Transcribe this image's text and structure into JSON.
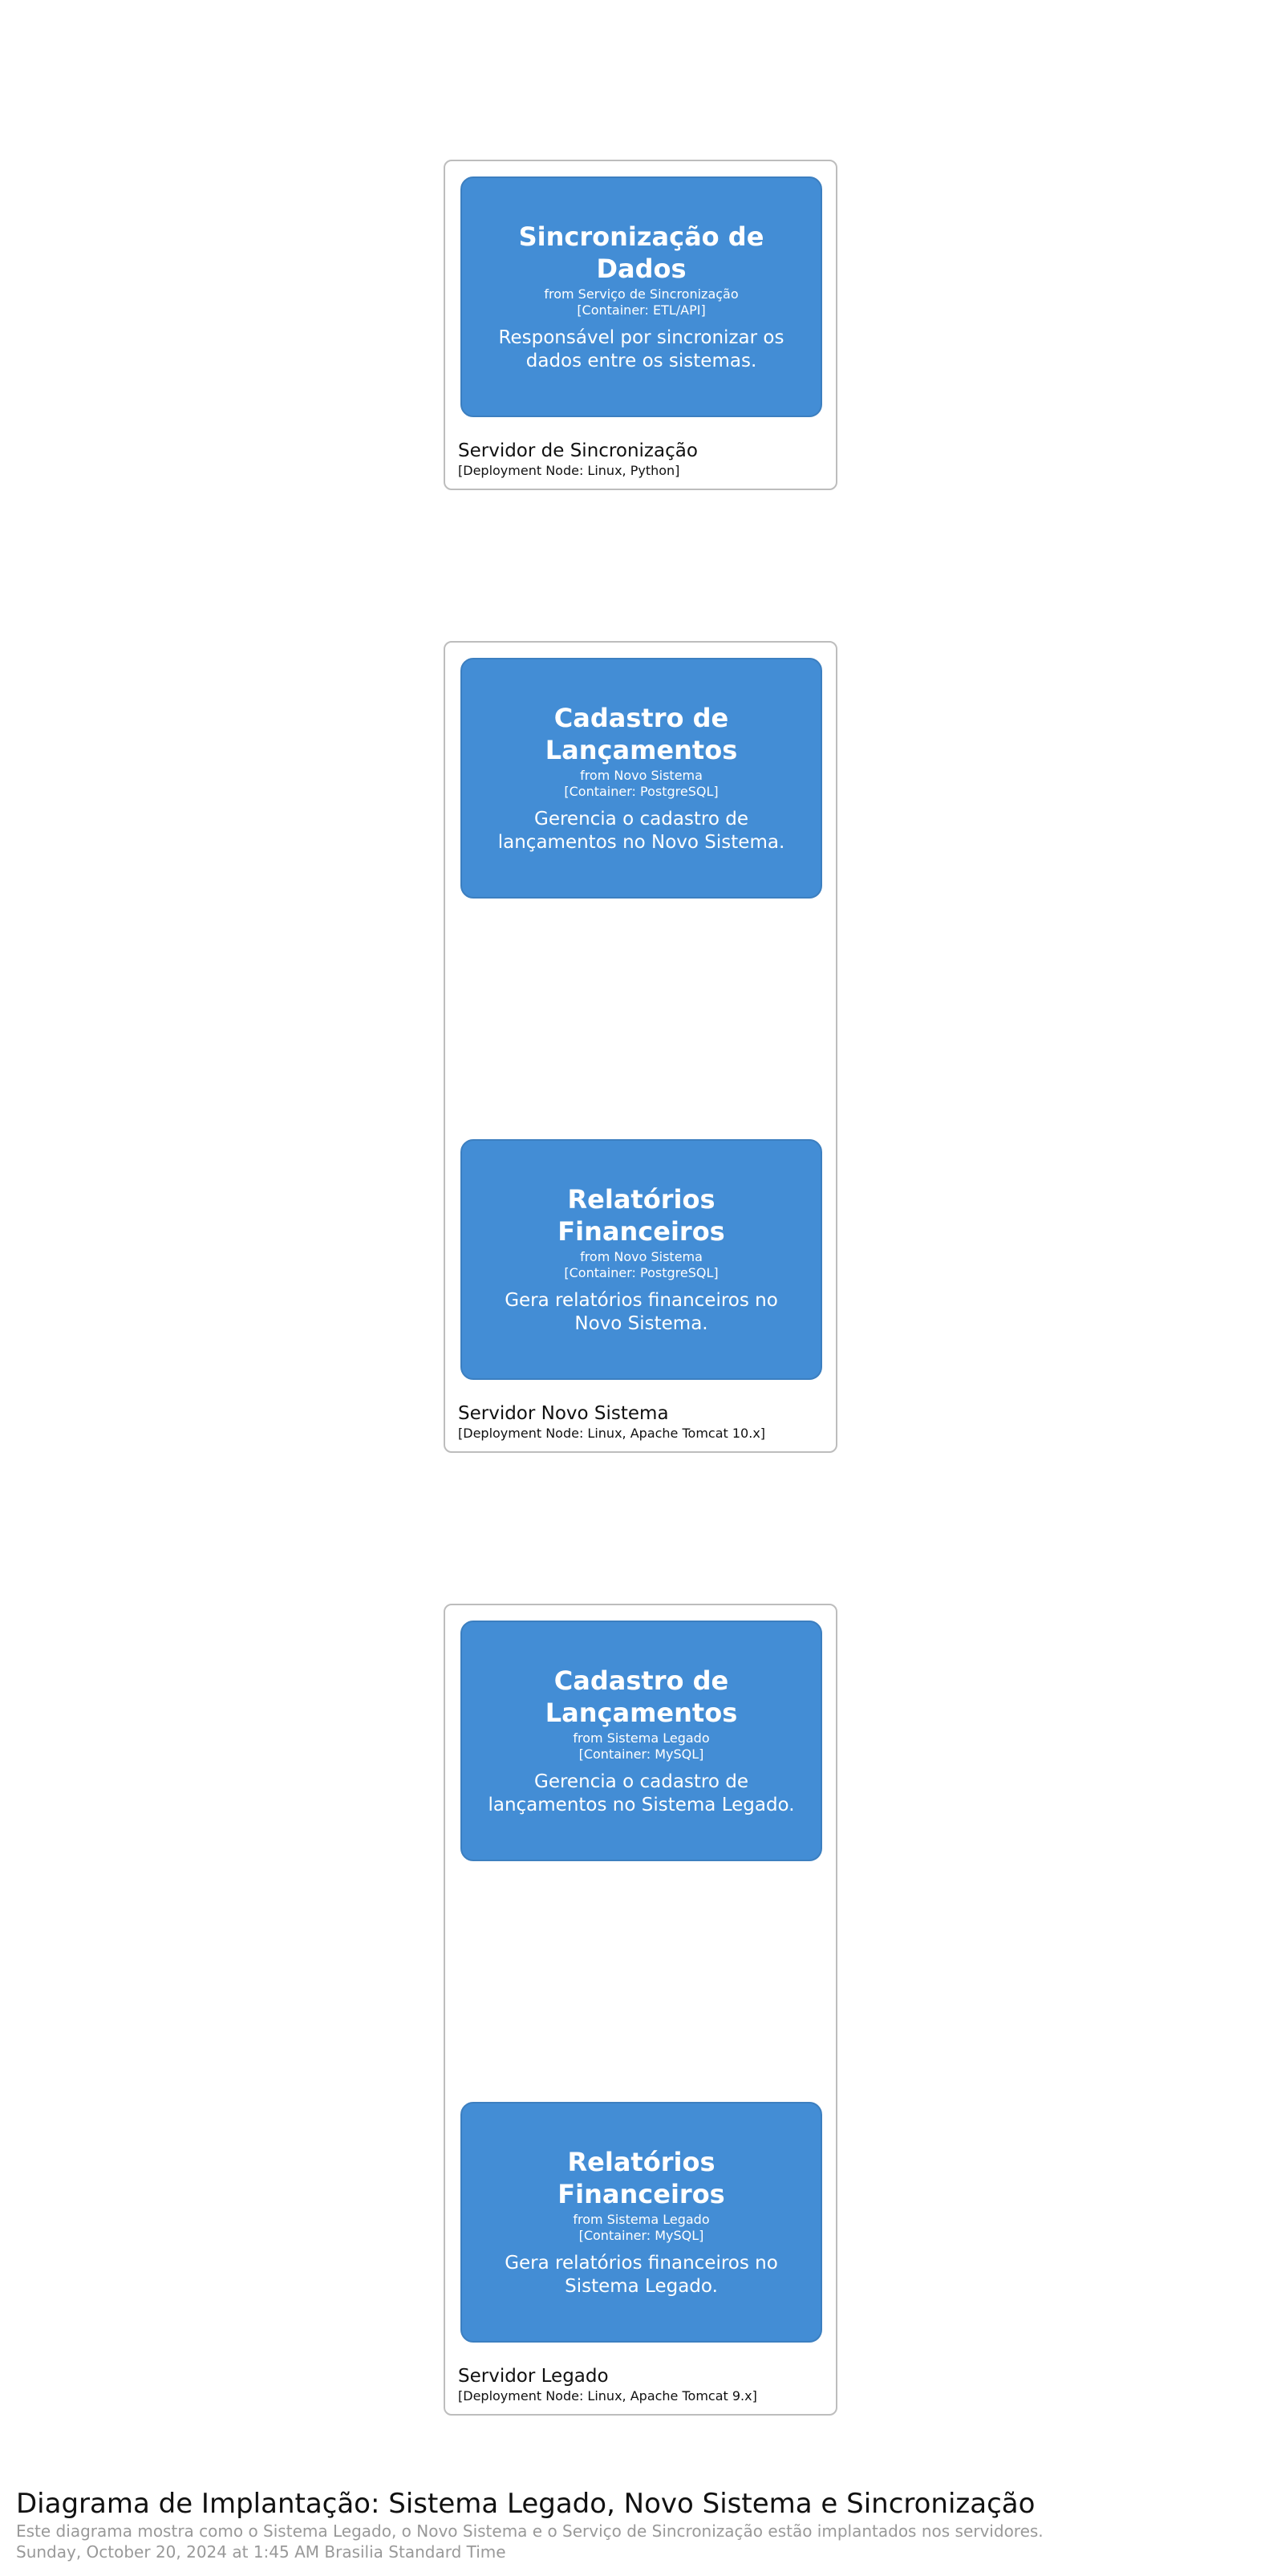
{
  "nodes": [
    {
      "name": "Servidor de Sincronização",
      "tech": "[Deployment Node: Linux, Python]",
      "containers": [
        {
          "name": "Sincronização de Dados",
          "from": "from Serviço de Sincronização",
          "tech": "[Container: ETL/API]",
          "description": "Responsável por sincronizar os dados entre os sistemas."
        }
      ]
    },
    {
      "name": "Servidor Novo Sistema",
      "tech": "[Deployment Node: Linux, Apache Tomcat 10.x]",
      "containers": [
        {
          "name": "Cadastro de Lançamentos",
          "from": "from Novo Sistema",
          "tech": "[Container: PostgreSQL]",
          "description": "Gerencia o cadastro de lançamentos no Novo Sistema."
        },
        {
          "name": "Relatórios Financeiros",
          "from": "from Novo Sistema",
          "tech": "[Container: PostgreSQL]",
          "description": "Gera relatórios financeiros no Novo Sistema."
        }
      ]
    },
    {
      "name": "Servidor Legado",
      "tech": "[Deployment Node: Linux, Apache Tomcat 9.x]",
      "containers": [
        {
          "name": "Cadastro de Lançamentos",
          "from": "from Sistema Legado",
          "tech": "[Container: MySQL]",
          "description": "Gerencia o cadastro de lançamentos no Sistema Legado."
        },
        {
          "name": "Relatórios Financeiros",
          "from": "from Sistema Legado",
          "tech": "[Container: MySQL]",
          "description": "Gera relatórios financeiros no Sistema Legado."
        }
      ]
    }
  ],
  "footer": {
    "title": "Diagrama de Implantação: Sistema Legado, Novo Sistema e Sincronização",
    "description": "Este diagrama mostra como o Sistema Legado, o Novo Sistema e o Serviço de Sincronização estão implantados nos servidores.",
    "date": "Sunday, October 20, 2024 at 1:45 AM Brasilia Standard Time"
  },
  "colors": {
    "container_fill": "#438dd5",
    "container_border": "#3c7fc0",
    "node_border": "#bdbdbd",
    "footer_muted": "#999999"
  }
}
